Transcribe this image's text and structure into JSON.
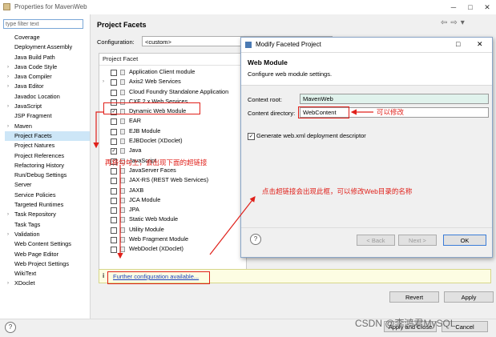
{
  "window": {
    "title": "Properties for MavenWeb",
    "buttons": [
      "─",
      "□",
      "✕"
    ]
  },
  "sidebar": {
    "filter_placeholder": "type filter text",
    "items": [
      {
        "label": "Coverage",
        "expandable": false,
        "selected": false
      },
      {
        "label": "Deployment Assembly",
        "expandable": false,
        "selected": false
      },
      {
        "label": "Java Build Path",
        "expandable": false,
        "selected": false
      },
      {
        "label": "Java Code Style",
        "expandable": true,
        "selected": false
      },
      {
        "label": "Java Compiler",
        "expandable": true,
        "selected": false
      },
      {
        "label": "Java Editor",
        "expandable": true,
        "selected": false
      },
      {
        "label": "Javadoc Location",
        "expandable": false,
        "selected": false
      },
      {
        "label": "JavaScript",
        "expandable": true,
        "selected": false
      },
      {
        "label": "JSP Fragment",
        "expandable": false,
        "selected": false
      },
      {
        "label": "Maven",
        "expandable": true,
        "selected": false
      },
      {
        "label": "Project Facets",
        "expandable": false,
        "selected": true
      },
      {
        "label": "Project Natures",
        "expandable": false,
        "selected": false
      },
      {
        "label": "Project References",
        "expandable": false,
        "selected": false
      },
      {
        "label": "Refactoring History",
        "expandable": false,
        "selected": false
      },
      {
        "label": "Run/Debug Settings",
        "expandable": false,
        "selected": false
      },
      {
        "label": "Server",
        "expandable": false,
        "selected": false
      },
      {
        "label": "Service Policies",
        "expandable": false,
        "selected": false
      },
      {
        "label": "Targeted Runtimes",
        "expandable": false,
        "selected": false
      },
      {
        "label": "Task Repository",
        "expandable": true,
        "selected": false
      },
      {
        "label": "Task Tags",
        "expandable": false,
        "selected": false
      },
      {
        "label": "Validation",
        "expandable": true,
        "selected": false
      },
      {
        "label": "Web Content Settings",
        "expandable": false,
        "selected": false
      },
      {
        "label": "Web Page Editor",
        "expandable": false,
        "selected": false
      },
      {
        "label": "Web Project Settings",
        "expandable": false,
        "selected": false
      },
      {
        "label": "WikiText",
        "expandable": false,
        "selected": false
      },
      {
        "label": "XDoclet",
        "expandable": true,
        "selected": false
      }
    ]
  },
  "main": {
    "title": "Project Facets",
    "configuration_label": "Configuration:",
    "configuration_value": "<custom>",
    "facet_header": "Project Facet",
    "facets": [
      {
        "label": "Application Client module",
        "checked": false,
        "expandable": false
      },
      {
        "label": "Axis2 Web Services",
        "checked": false,
        "expandable": true
      },
      {
        "label": "Cloud Foundry Standalone Application",
        "checked": false,
        "expandable": false
      },
      {
        "label": "CXF 2.x Web Services",
        "checked": false,
        "expandable": false
      },
      {
        "label": "Dynamic Web Module",
        "checked": true,
        "expandable": false
      },
      {
        "label": "EAR",
        "checked": false,
        "expandable": false
      },
      {
        "label": "EJB Module",
        "checked": false,
        "expandable": false
      },
      {
        "label": "EJBDoclet (XDoclet)",
        "checked": false,
        "expandable": false
      },
      {
        "label": "Java",
        "checked": true,
        "expandable": false
      },
      {
        "label": "JavaScript",
        "checked": true,
        "expandable": false
      },
      {
        "label": "JavaServer Faces",
        "checked": false,
        "expandable": false
      },
      {
        "label": "JAX-RS (REST Web Services)",
        "checked": false,
        "expandable": false
      },
      {
        "label": "JAXB",
        "checked": false,
        "expandable": false
      },
      {
        "label": "JCA Module",
        "checked": false,
        "expandable": false
      },
      {
        "label": "JPA",
        "checked": false,
        "expandable": false
      },
      {
        "label": "Static Web Module",
        "checked": false,
        "expandable": false
      },
      {
        "label": "Utility Module",
        "checked": false,
        "expandable": false
      },
      {
        "label": "Web Fragment Module",
        "checked": false,
        "expandable": false
      },
      {
        "label": "WebDoclet (XDoclet)",
        "checked": false,
        "expandable": false
      }
    ],
    "info_icon": "i",
    "info_link": "Further configuration available...",
    "revert_label": "Revert",
    "apply_label": "Apply"
  },
  "bottom": {
    "help_icon": "?",
    "apply_close_label": "Apply and Close",
    "cancel_label": "Cancel"
  },
  "dialog": {
    "title": "Modify Faceted Project",
    "header_title": "Web Module",
    "header_desc": "Configure web module settings.",
    "context_root_label": "Context root:",
    "context_root_value": "MavenWeb",
    "content_dir_label": "Content directory:",
    "content_dir_value": "WebContent",
    "generate_label": "Generate web.xml deployment descriptor",
    "generate_checked": true,
    "help_icon": "?",
    "back_label": "< Back",
    "next_label": "Next >",
    "ok_label": "OK",
    "close_icon": "✕",
    "maximize_icon": "□"
  },
  "annotations": {
    "editable_note": "可以修改",
    "check_note": "再将勾勾上，会出现下面的超链接",
    "click_note": "点击超链接会出现此框，可以修改Web目录的名称"
  },
  "watermark": "CSDN @李鸿君MySQL",
  "colors": {
    "annotation_red": "#e0201a",
    "selection_blue": "#cde6f7",
    "link_blue": "#1a3fbf",
    "context_root_bg": "#e0f2ec"
  }
}
